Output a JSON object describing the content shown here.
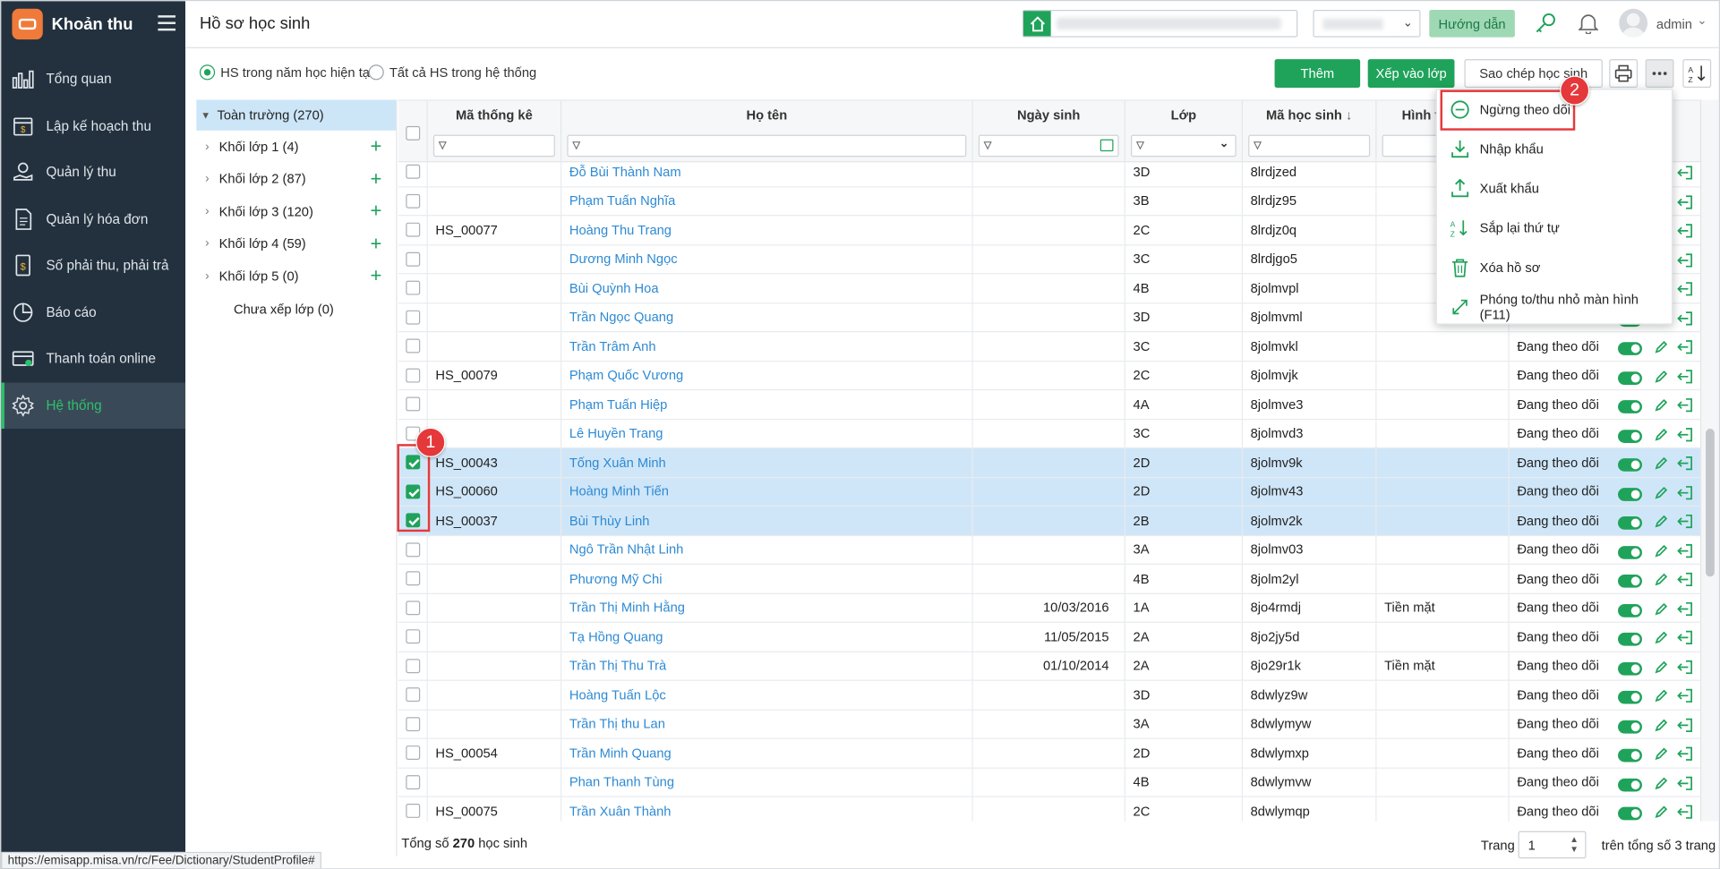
{
  "app": {
    "name": "Khoản thu",
    "status_url": "https://emisapp.misa.vn/rc/Fee/Dictionary/StudentProfile#"
  },
  "sidebar": {
    "items": [
      {
        "label": "Tổng quan",
        "icon": "bar-chart-icon"
      },
      {
        "label": "Lập kế hoạch thu",
        "icon": "money-calendar-icon"
      },
      {
        "label": "Quản lý thu",
        "icon": "hand-coin-icon"
      },
      {
        "label": "Quản lý hóa đơn",
        "icon": "invoice-icon"
      },
      {
        "label": "Số phải thu, phải trả",
        "icon": "ledger-book-icon"
      },
      {
        "label": "Báo cáo",
        "icon": "pie-chart-icon"
      },
      {
        "label": "Thanh toán online",
        "icon": "card-payment-icon"
      },
      {
        "label": "Hệ thống",
        "icon": "gear-icon",
        "active": true
      }
    ]
  },
  "header": {
    "title": "Hồ sơ học sinh",
    "guide_label": "Hướng dẫn",
    "user": "admin"
  },
  "toolbar": {
    "radio_current": "HS trong năm học hiện tại",
    "radio_all": "Tất cả HS trong hệ thống",
    "add_label": "Thêm",
    "assign_label": "Xếp vào lớp",
    "copy_label": "Sao chép học sinh"
  },
  "tree": {
    "root": "Toàn trường (270)",
    "items": [
      "Khối lớp 1 (4)",
      "Khối lớp 2 (87)",
      "Khối lớp 3 (120)",
      "Khối lớp 4 (59)",
      "Khối lớp 5 (0)"
    ],
    "unassigned": "Chưa xếp lớp (0)"
  },
  "grid": {
    "columns": {
      "stat_code": "Mã thống kê",
      "name": "Họ tên",
      "dob": "Ngày sinh",
      "class": "Lớp",
      "student_code": "Mã học sinh",
      "payment": "Hình t"
    },
    "rows": [
      {
        "stat": "",
        "name": "Đỗ Bùi Thành Nam",
        "dob": "",
        "cls": "3D",
        "code": "8lrdjzed",
        "pay": "",
        "status": "",
        "sel": false
      },
      {
        "stat": "",
        "name": "Phạm Tuấn Nghĩa",
        "dob": "",
        "cls": "3B",
        "code": "8lrdjz95",
        "pay": "",
        "status": "",
        "sel": false
      },
      {
        "stat": "HS_00077",
        "name": "Hoàng Thu Trang",
        "dob": "",
        "cls": "2C",
        "code": "8lrdjz0q",
        "pay": "",
        "status": "",
        "sel": false
      },
      {
        "stat": "",
        "name": "Dương Minh Ngọc",
        "dob": "",
        "cls": "3C",
        "code": "8lrdjgo5",
        "pay": "",
        "status": "",
        "sel": false
      },
      {
        "stat": "",
        "name": "Bùi Quỳnh Hoa",
        "dob": "",
        "cls": "4B",
        "code": "8jolmvpl",
        "pay": "",
        "status": "",
        "sel": false
      },
      {
        "stat": "",
        "name": "Trần Ngọc Quang",
        "dob": "",
        "cls": "3D",
        "code": "8jolmvml",
        "pay": "",
        "status": "",
        "sel": false
      },
      {
        "stat": "",
        "name": "Trần Trâm Anh",
        "dob": "",
        "cls": "3C",
        "code": "8jolmvkl",
        "pay": "",
        "status": "Đang theo dõi",
        "sel": false
      },
      {
        "stat": "HS_00079",
        "name": "Phạm Quốc Vương",
        "dob": "",
        "cls": "2C",
        "code": "8jolmvjk",
        "pay": "",
        "status": "Đang theo dõi",
        "sel": false
      },
      {
        "stat": "",
        "name": "Phạm Tuấn Hiệp",
        "dob": "",
        "cls": "4A",
        "code": "8jolmve3",
        "pay": "",
        "status": "Đang theo dõi",
        "sel": false
      },
      {
        "stat": "",
        "name": "Lê Huyền Trang",
        "dob": "",
        "cls": "3C",
        "code": "8jolmvd3",
        "pay": "",
        "status": "Đang theo dõi",
        "sel": false
      },
      {
        "stat": "HS_00043",
        "name": "Tống Xuân Minh",
        "dob": "",
        "cls": "2D",
        "code": "8jolmv9k",
        "pay": "",
        "status": "Đang theo dõi",
        "sel": true
      },
      {
        "stat": "HS_00060",
        "name": "Hoàng Minh Tiến",
        "dob": "",
        "cls": "2D",
        "code": "8jolmv43",
        "pay": "",
        "status": "Đang theo dõi",
        "sel": true
      },
      {
        "stat": "HS_00037",
        "name": "Bùi Thùy Linh",
        "dob": "",
        "cls": "2B",
        "code": "8jolmv2k",
        "pay": "",
        "status": "Đang theo dõi",
        "sel": true
      },
      {
        "stat": "",
        "name": "Ngô Trần Nhật Linh",
        "dob": "",
        "cls": "3A",
        "code": "8jolmv03",
        "pay": "",
        "status": "Đang theo dõi",
        "sel": false
      },
      {
        "stat": "",
        "name": "Phương Mỹ Chi",
        "dob": "",
        "cls": "4B",
        "code": "8jolm2yl",
        "pay": "",
        "status": "Đang theo dõi",
        "sel": false
      },
      {
        "stat": "",
        "name": "Trần Thị Minh Hằng",
        "dob": "10/03/2016",
        "cls": "1A",
        "code": "8jo4rmdj",
        "pay": "Tiền mặt",
        "status": "Đang theo dõi",
        "sel": false
      },
      {
        "stat": "",
        "name": "Tạ Hồng Quang",
        "dob": "11/05/2015",
        "cls": "2A",
        "code": "8jo2jy5d",
        "pay": "",
        "status": "Đang theo dõi",
        "sel": false
      },
      {
        "stat": "",
        "name": "Trần Thị Thu Trà",
        "dob": "01/10/2014",
        "cls": "2A",
        "code": "8jo29r1k",
        "pay": "Tiền mặt",
        "status": "Đang theo dõi",
        "sel": false
      },
      {
        "stat": "",
        "name": "Hoàng Tuấn Lộc",
        "dob": "",
        "cls": "3D",
        "code": "8dwlyz9w",
        "pay": "",
        "status": "Đang theo dõi",
        "sel": false
      },
      {
        "stat": "",
        "name": "Trần Thị thu Lan",
        "dob": "",
        "cls": "3A",
        "code": "8dwlymyw",
        "pay": "",
        "status": "Đang theo dõi",
        "sel": false
      },
      {
        "stat": "HS_00054",
        "name": "Trần Minh Quang",
        "dob": "",
        "cls": "2D",
        "code": "8dwlymxp",
        "pay": "",
        "status": "Đang theo dõi",
        "sel": false
      },
      {
        "stat": "",
        "name": "Phan Thanh Tùng",
        "dob": "",
        "cls": "4B",
        "code": "8dwlymvw",
        "pay": "",
        "status": "Đang theo dõi",
        "sel": false
      },
      {
        "stat": "HS_00075",
        "name": "Trần Xuân Thành",
        "dob": "",
        "cls": "2C",
        "code": "8dwlymqp",
        "pay": "",
        "status": "Đang theo dõi",
        "sel": false
      }
    ]
  },
  "footer": {
    "total_prefix": "Tổng số",
    "total_count": "270",
    "total_suffix": "học sinh",
    "page_label": "Trang",
    "page_value": "1",
    "page_total": "trên tổng số 3 trang"
  },
  "menu": {
    "items": [
      {
        "label": "Ngừng theo dõi",
        "icon": "minus-circle-icon"
      },
      {
        "label": "Nhập khẩu",
        "icon": "import-icon"
      },
      {
        "label": "Xuất khẩu",
        "icon": "export-icon"
      },
      {
        "label": "Sắp lại thứ tự",
        "icon": "sort-az-icon"
      },
      {
        "label": "Xóa hồ sơ",
        "icon": "trash-icon"
      },
      {
        "label": "Phóng to/thu nhỏ màn hình (F11)",
        "icon": "fullscreen-icon"
      }
    ]
  },
  "annotations": {
    "step1": "1",
    "step2": "2"
  },
  "colors": {
    "accent": "#1fa35a",
    "sidebar": "#23313f",
    "highlight": "#e5383b",
    "selected_row": "#cfe6f8",
    "link": "#2e8ad3"
  }
}
